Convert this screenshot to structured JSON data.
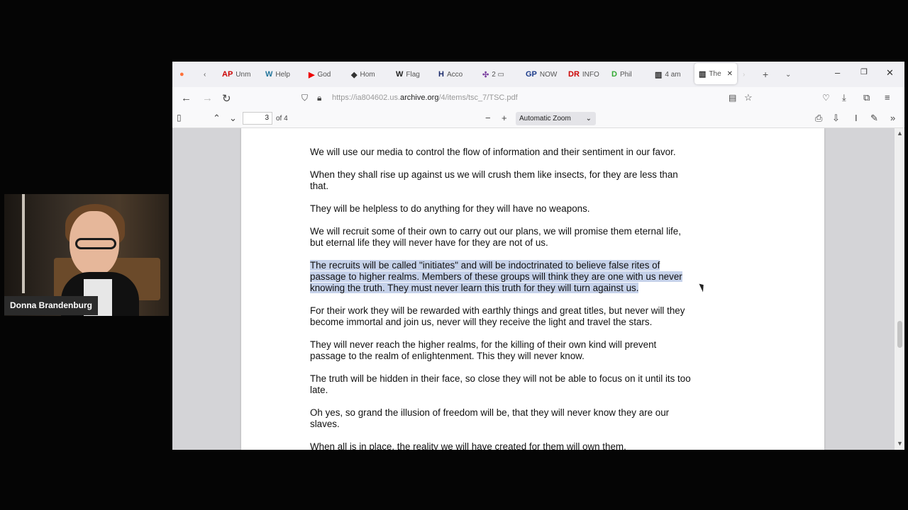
{
  "webcam": {
    "name": "Donna Brandenburg"
  },
  "tabs": [
    {
      "icon": "AP",
      "label": "Unm",
      "color": "#c00"
    },
    {
      "icon": "W",
      "label": "Help",
      "color": "#21759b"
    },
    {
      "icon": "▶",
      "label": "God",
      "color": "#e00"
    },
    {
      "icon": "◆",
      "label": "Hom",
      "color": "#333"
    },
    {
      "icon": "W",
      "label": "Flag",
      "color": "#222"
    },
    {
      "icon": "H",
      "label": "Acco",
      "color": "#1a2a6a"
    },
    {
      "icon": "✣",
      "label": "2 ▭",
      "color": "#7a3fa0"
    },
    {
      "icon": "GP",
      "label": "NOW",
      "color": "#1a3a8a"
    },
    {
      "icon": "DR",
      "label": "INFO",
      "color": "#c00"
    },
    {
      "icon": "D",
      "label": "Phil",
      "color": "#3a3"
    },
    {
      "icon": "▥",
      "label": "4 am",
      "color": "#222"
    },
    {
      "icon": "▥",
      "label": "The",
      "color": "#222"
    }
  ],
  "url": {
    "prefix": "https://ia804602.us.",
    "host": "archive.org",
    "path": "/4/items/tsc_7/TSC.pdf"
  },
  "pdf": {
    "page": "3",
    "page_of": "of 4",
    "zoom": "Automatic Zoom"
  },
  "paragraphs": [
    {
      "lines": [
        "We will use our media to control the flow of information and their sentiment in our favor."
      ],
      "highlight": false
    },
    {
      "lines": [
        "When they shall rise up against us we will crush them like insects, for they are less than",
        "that."
      ],
      "highlight": false
    },
    {
      "lines": [
        "They will be helpless to do anything for they will have no weapons."
      ],
      "highlight": false
    },
    {
      "lines": [
        "We will recruit some of their own to carry out our plans, we will promise them eternal life,",
        "but eternal life they will never have for they are not of us."
      ],
      "highlight": false
    },
    {
      "lines": [
        "The recruits will be called \"initiates\" and will be indoctrinated to believe false rites of",
        "passage to higher realms. Members of these groups will think they are one with us never",
        "knowing the truth. They must never learn this truth for they will turn against us."
      ],
      "highlight": true
    },
    {
      "lines": [
        "For their work they will be rewarded with earthly things and great titles, but never will they",
        "become immortal and join us, never will they receive the light and travel the stars."
      ],
      "highlight": false
    },
    {
      "lines": [
        "They will never reach the higher realms, for the killing of their own kind will prevent",
        "passage to the realm of enlightenment. This they will never know."
      ],
      "highlight": false
    },
    {
      "lines": [
        "The truth will be hidden in their face, so close they will not be able to focus on it until its too",
        "late."
      ],
      "highlight": false
    },
    {
      "lines": [
        "Oh yes, so grand the illusion of freedom will be, that they will never know they are our",
        "slaves."
      ],
      "highlight": false
    },
    {
      "lines": [
        "When all is in place, the reality we will have created for them will own them."
      ],
      "highlight": false
    }
  ]
}
